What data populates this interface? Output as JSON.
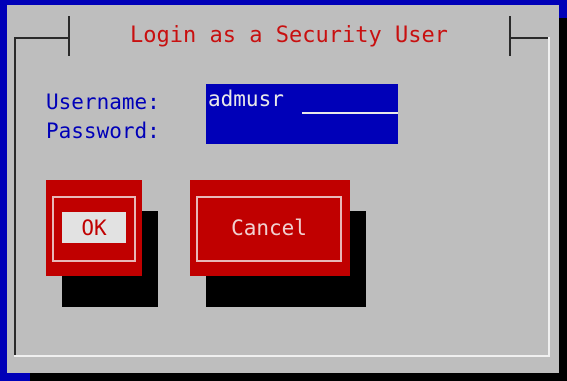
{
  "dialog": {
    "title": "Login as a Security User"
  },
  "form": {
    "username_label": "Username:",
    "username_value": "admusr",
    "password_label": "Password:",
    "password_value": ""
  },
  "buttons": {
    "ok_label": "OK",
    "cancel_label": "Cancel"
  },
  "colors": {
    "background": "#0000b8",
    "dialog": "#bebebe",
    "accent": "#c00000",
    "field": "#0000b8"
  }
}
